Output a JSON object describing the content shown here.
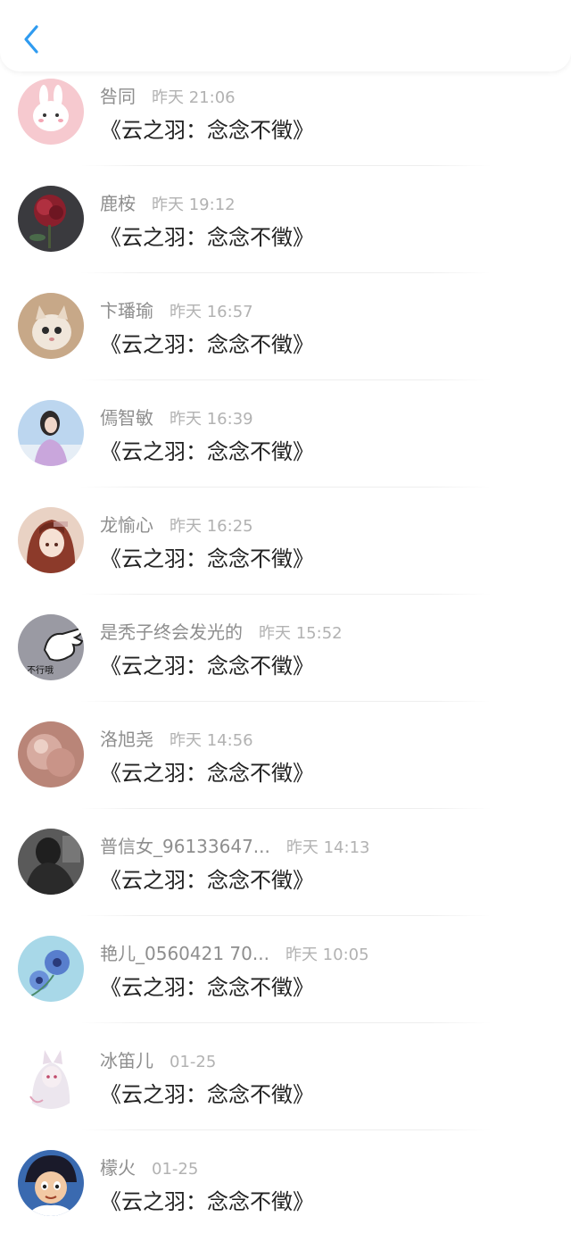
{
  "header": {
    "back_icon": "chevron-left-icon",
    "accent": "#2f9bf0"
  },
  "comments": [
    {
      "name": "咎同",
      "time": "昨天 21:06",
      "text": "《云之羽：念念不徵》",
      "avatar": "rabbit"
    },
    {
      "name": "鹿桉",
      "time": "昨天 19:12",
      "text": "《云之羽：念念不徵》",
      "avatar": "rose"
    },
    {
      "name": "卞璠瑜",
      "time": "昨天 16:57",
      "text": "《云之羽：念念不徵》",
      "avatar": "cat"
    },
    {
      "name": "傿智敏",
      "time": "昨天 16:39",
      "text": "《云之羽：念念不徵》",
      "avatar": "girl"
    },
    {
      "name": "龙愉心",
      "time": "昨天 16:25",
      "text": "《云之羽：念念不徵》",
      "avatar": "anime"
    },
    {
      "name": "是秃子终会发光的",
      "time": "昨天 15:52",
      "text": "《云之羽：念念不徵》",
      "avatar": "hand",
      "avatar_caption": "不行哦"
    },
    {
      "name": "洛旭尧",
      "time": "昨天 14:56",
      "text": "《云之羽：念念不徵》",
      "avatar": "pink"
    },
    {
      "name": "普信女_96133647...",
      "time": "昨天 14:13",
      "text": "《云之羽：念念不徵》",
      "avatar": "dark"
    },
    {
      "name": "艳儿_0560421 70...",
      "time": "昨天 10:05",
      "text": "《云之羽：念念不徵》",
      "avatar": "flower"
    },
    {
      "name": "冰笛儿",
      "time": "01-25",
      "text": "《云之羽：念念不徵》",
      "avatar": "fox"
    },
    {
      "name": "檬火",
      "time": "01-25",
      "text": "《云之羽：念念不徵》",
      "avatar": "boy"
    }
  ]
}
